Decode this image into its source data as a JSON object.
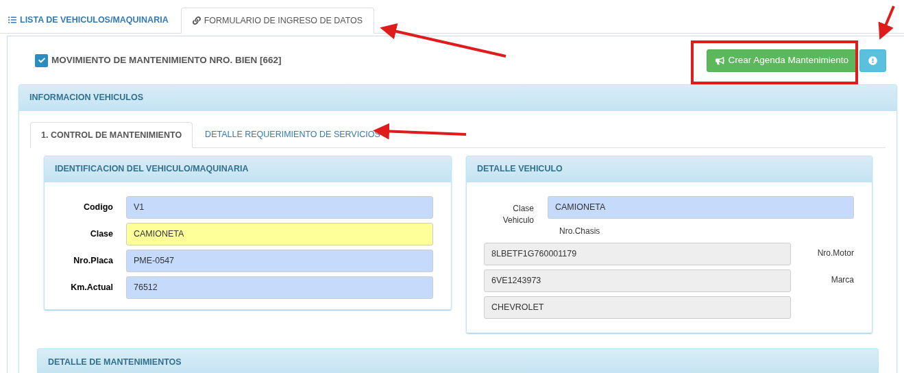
{
  "top_tabs": [
    {
      "label": "LISTA DE VEHICULOS/MAQUINARIA",
      "kind": "list",
      "selected": false
    },
    {
      "label": "FORMULARIO DE INGRESO DE DATOS",
      "kind": "form",
      "selected": true
    }
  ],
  "header": {
    "checked": true,
    "title": "MOVIMIENTO DE MANTENIMIENTO NRO. BIEN [662]"
  },
  "buttons": [
    {
      "kind": "success",
      "label": "Crear Agenda Mantenimiento"
    },
    {
      "kind": "info"
    }
  ],
  "info_panel": {
    "title": "INFORMACION VEHICULOS",
    "tabs": [
      {
        "label": "1. CONTROL DE MANTENIMIENTO",
        "selected": true
      },
      {
        "label": "DETALLE REQUERIMIENTO DE SERVICIOS",
        "selected": false
      }
    ],
    "identification": {
      "title": "IDENTIFICACION DEL VEHICULO/MAQUINARIA",
      "fields": [
        {
          "label": "Codigo",
          "value": "V1",
          "highlighted": false
        },
        {
          "label": "Clase",
          "value": "CAMIONETA",
          "highlighted": true
        },
        {
          "label": "Nro.Placa",
          "value": "PME-0547",
          "highlighted": false
        },
        {
          "label": "Km.Actual",
          "value": "76512",
          "highlighted": false
        }
      ]
    },
    "detail": {
      "title": "DETALLE VEHICULO",
      "class_label": "Clase Vehiculo",
      "class_value": "CAMIONETA",
      "chasis_label": "Nro.Chasis",
      "rows": [
        {
          "value": "8LBETF1G760001179",
          "label": "Nro.Motor"
        },
        {
          "value": "6VE1243973",
          "label": "Marca"
        },
        {
          "value": "CHEVROLET"
        }
      ]
    }
  },
  "maintenance_panel": {
    "title": "DETALLE DE MANTENIMIENTOS"
  }
}
